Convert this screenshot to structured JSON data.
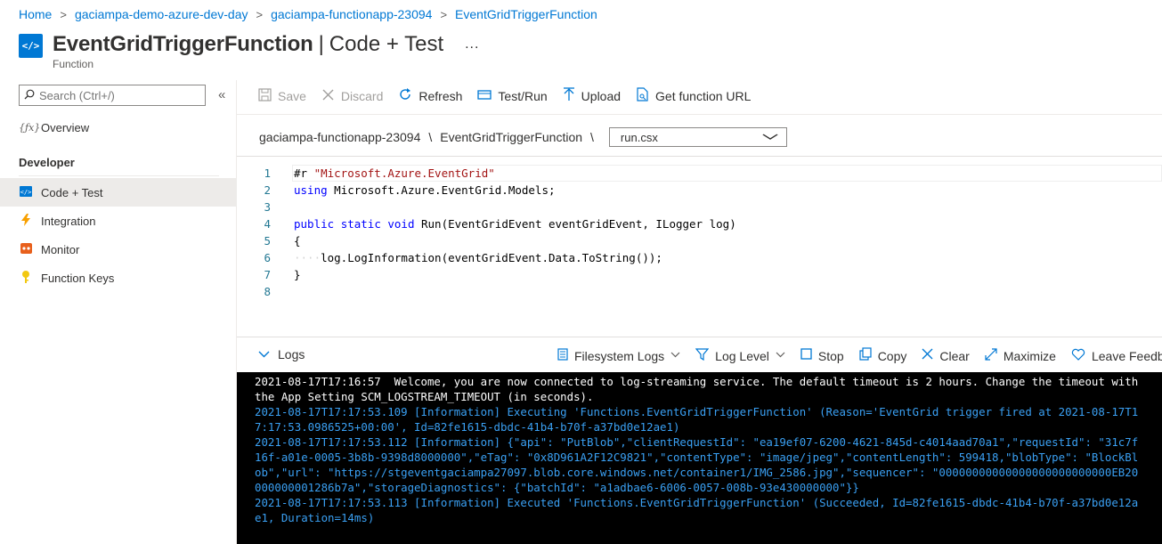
{
  "breadcrumb": {
    "items": [
      "Home",
      "gaciampa-demo-azure-dev-day",
      "gaciampa-functionapp-23094",
      "EventGridTriggerFunction"
    ],
    "separator": ">"
  },
  "header": {
    "icon_text": "</>",
    "title": "EventGridTriggerFunction",
    "separator": "|",
    "subtitle": "Code + Test",
    "more": "...",
    "resource_type": "Function"
  },
  "sidebar": {
    "search_placeholder": "Search (Ctrl+/)",
    "collapse": "«",
    "overview": "Overview",
    "section": "Developer",
    "items": [
      "Code + Test",
      "Integration",
      "Monitor",
      "Function Keys"
    ]
  },
  "toolbar": {
    "save": "Save",
    "discard": "Discard",
    "refresh": "Refresh",
    "test_run": "Test/Run",
    "upload": "Upload",
    "get_url": "Get function URL"
  },
  "file_path": {
    "app": "gaciampa-functionapp-23094",
    "function": "EventGridTriggerFunction",
    "separator": "\\",
    "selected_file": "run.csx"
  },
  "editor": {
    "line_numbers": [
      "1",
      "2",
      "3",
      "4",
      "5",
      "6",
      "7",
      "8"
    ],
    "lines": {
      "l1_directive": "#r ",
      "l1_string": "\"Microsoft.Azure.EventGrid\"",
      "l2_kw": "using",
      "l2_rest": " Microsoft.Azure.EventGrid.Models;",
      "l4_kw1": "public",
      "l4_kw2": "static",
      "l4_kw3": "void",
      "l4_rest": " Run(EventGridEvent eventGridEvent, ILogger log)",
      "l5": "{",
      "l6_ws": "····",
      "l6_rest": "log.LogInformation(eventGridEvent.Data.ToString());",
      "l7": "}"
    }
  },
  "logs": {
    "toggle": "Logs",
    "filesystem": "Filesystem Logs",
    "log_level": "Log Level",
    "stop": "Stop",
    "copy": "Copy",
    "clear": "Clear",
    "maximize": "Maximize",
    "feedback": "Leave Feedback",
    "entries": [
      "2021-08-17T17:16:57  Welcome, you are now connected to log-streaming service. The default timeout is 2 hours. Change the timeout with the App Setting SCM_LOGSTREAM_TIMEOUT (in seconds).",
      "2021-08-17T17:17:53.109 [Information] Executing 'Functions.EventGridTriggerFunction' (Reason='EventGrid trigger fired at 2021-08-17T17:17:53.0986525+00:00', Id=82fe1615-dbdc-41b4-b70f-a37bd0e12ae1)",
      "2021-08-17T17:17:53.112 [Information] {\"api\": \"PutBlob\",\"clientRequestId\": \"ea19ef07-6200-4621-845d-c4014aad70a1\",\"requestId\": \"31c7f16f-a01e-0005-3b8b-9398d8000000\",\"eTag\": \"0x8D961A2F12C9821\",\"contentType\": \"image/jpeg\",\"contentLength\": 599418,\"blobType\": \"BlockBlob\",\"url\": \"https://stgeventgaciampa27097.blob.core.windows.net/container1/IMG_2586.jpg\",\"sequencer\": \"00000000000000000000000000EB20000000001286b7a\",\"storageDiagnostics\": {\"batchId\": \"a1adbae6-6006-0057-008b-93e430000000\"}}",
      "2021-08-17T17:17:53.113 [Information] Executed 'Functions.EventGridTriggerFunction' (Succeeded, Id=82fe1615-dbdc-41b4-b70f-a37bd0e12ae1, Duration=14ms)"
    ]
  },
  "colors": {
    "accent": "#0078d4",
    "console_bg": "#000000",
    "console_info": "#3aa0f3",
    "console_text": "#ffffff"
  }
}
